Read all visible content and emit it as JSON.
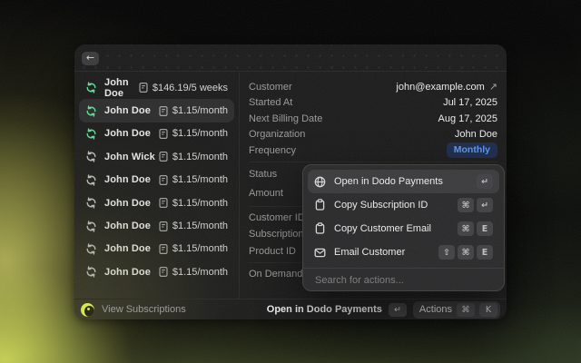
{
  "window": {
    "header": {
      "back_icon": "←"
    }
  },
  "subscriptions": {
    "rows": [
      {
        "name": "John Doe",
        "price": "$146.19/5 weeks",
        "icon": "green",
        "selected": false
      },
      {
        "name": "John Doe",
        "price": "$1.15/month",
        "icon": "green",
        "selected": true
      },
      {
        "name": "John Doe",
        "price": "$1.15/month",
        "icon": "green",
        "selected": false
      },
      {
        "name": "John Wick",
        "price": "$1.15/month",
        "icon": "gray",
        "selected": false
      },
      {
        "name": "John Doe",
        "price": "$1.15/month",
        "icon": "gray",
        "selected": false
      },
      {
        "name": "John Doe",
        "price": "$1.15/month",
        "icon": "gray",
        "selected": false
      },
      {
        "name": "John Doe",
        "price": "$1.15/month",
        "icon": "gray",
        "selected": false
      },
      {
        "name": "John Doe",
        "price": "$1.15/month",
        "icon": "gray",
        "selected": false
      },
      {
        "name": "John Doe",
        "price": "$1.15/month",
        "icon": "gray",
        "selected": false
      }
    ]
  },
  "details": {
    "customer_label": "Customer",
    "customer_value": "john@example.com",
    "customer_link_icon": "↗",
    "started_label": "Started At",
    "started_value": "Jul 17, 2025",
    "next_billing_label": "Next Billing Date",
    "next_billing_value": "Aug 17, 2025",
    "organization_label": "Organization",
    "organization_value": "John Doe",
    "frequency_label": "Frequency",
    "frequency_value": "Monthly",
    "status_label": "Status",
    "amount_label": "Amount",
    "customer_id_label": "Customer ID",
    "subscription_id_label": "Subscription ID",
    "product_id_label": "Product ID",
    "on_demand_label": "On Demand"
  },
  "action_menu": {
    "items": [
      {
        "label": "Open in Dodo Payments",
        "icon": "globe-icon",
        "keys": [
          "↵"
        ]
      },
      {
        "label": "Copy Subscription ID",
        "icon": "clipboard-icon",
        "keys": [
          "⌘",
          "↵"
        ]
      },
      {
        "label": "Copy Customer Email",
        "icon": "clipboard-icon",
        "keys": [
          "⌘",
          "E"
        ]
      },
      {
        "label": "Email Customer",
        "icon": "envelope-icon",
        "keys": [
          "⇧",
          "⌘",
          "E"
        ]
      }
    ],
    "search_placeholder": "Search for actions..."
  },
  "statusbar": {
    "view_label": "View Subscriptions",
    "primary_action": "Open in Dodo Payments",
    "primary_key": "↵",
    "actions_label": "Actions",
    "actions_keys": [
      "⌘",
      "K"
    ]
  },
  "colors": {
    "accent_blue": "#5B98F6",
    "badge_bg": "#1D2C4D",
    "green_icon": "#5FDF9A",
    "logo_yellow": "#D9E84E",
    "window_bg": "#1C1C1C"
  }
}
